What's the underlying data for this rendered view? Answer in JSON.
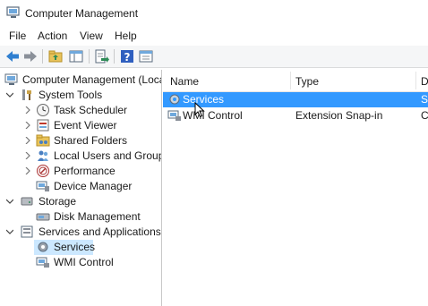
{
  "window": {
    "title": "Computer Management"
  },
  "menu": [
    "File",
    "Action",
    "View",
    "Help"
  ],
  "toolbar": {
    "buttons": [
      "back-arrow-icon",
      "forward-arrow-icon",
      "up-folder-icon",
      "show-hide-tree-icon",
      "export-list-icon",
      "help-icon",
      "properties-icon"
    ]
  },
  "tree": {
    "root": "Computer Management (Local",
    "system_tools": "System Tools",
    "task_scheduler": "Task Scheduler",
    "event_viewer": "Event Viewer",
    "shared_folders": "Shared Folders",
    "local_users": "Local Users and Groups",
    "performance": "Performance",
    "device_manager": "Device Manager",
    "storage": "Storage",
    "disk_management": "Disk Management",
    "services_apps": "Services and Applications",
    "services": "Services",
    "wmi_control": "WMI Control"
  },
  "list": {
    "columns": [
      "Name",
      "Type",
      "D"
    ],
    "rows": [
      {
        "name": "Services",
        "type": "",
        "desc": "Sl"
      },
      {
        "name": "WMI Control",
        "type": "Extension Snap-in",
        "desc": "C"
      }
    ]
  },
  "colors": {
    "selection": "#3399ff",
    "tree_selection": "#cce8ff"
  }
}
